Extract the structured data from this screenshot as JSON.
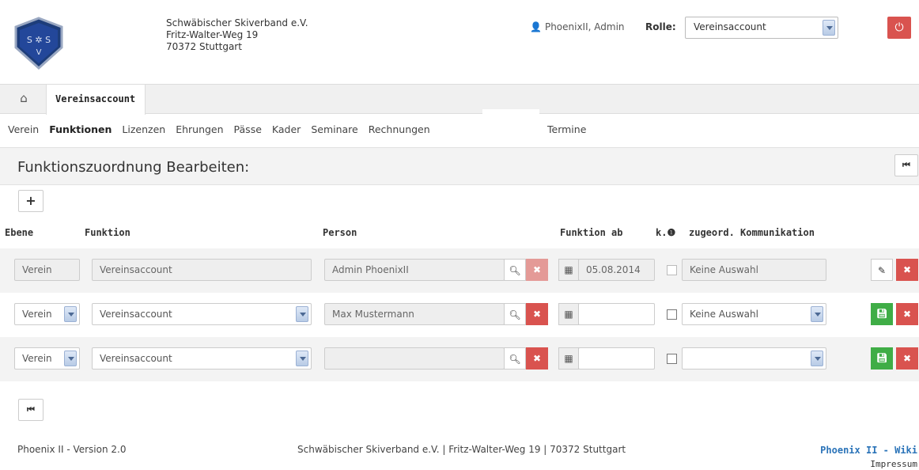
{
  "header": {
    "org_name": "Schwäbischer Skiverband e.V.",
    "org_street": "Fritz-Walter-Weg 19",
    "org_city": "70372 Stuttgart",
    "user": "PhoenixII, Admin",
    "role_label": "Rolle:",
    "role_value": "Vereinsaccount",
    "logo_text": "S S S V"
  },
  "tabs": {
    "active": "Vereinsaccount"
  },
  "subnav": {
    "items": [
      "Verein",
      "Funktionen",
      "Lizenzen",
      "Ehrungen",
      "Pässe",
      "Kader",
      "Seminare",
      "Rechnungen"
    ],
    "extra": "Termine"
  },
  "panel": {
    "title": "Funktionszuordnung Bearbeiten:"
  },
  "columns": {
    "ebene": "Ebene",
    "funktion": "Funktion",
    "person": "Person",
    "funktion_ab": "Funktion ab",
    "k": "k.",
    "kommunikation": "zugeord. Kommunikation"
  },
  "rows": [
    {
      "ebene": "Verein",
      "funktion": "Vereinsaccount",
      "person": "Admin PhoenixII",
      "datum": "05.08.2014",
      "kommunikation": "Keine Auswahl",
      "mode": "readonly"
    },
    {
      "ebene": "Verein",
      "funktion": "Vereinsaccount",
      "person": "Max Mustermann",
      "datum": "",
      "kommunikation": "Keine Auswahl",
      "mode": "edit"
    },
    {
      "ebene": "Verein",
      "funktion": "Vereinsaccount",
      "person": "",
      "datum": "",
      "kommunikation": "",
      "mode": "edit"
    }
  ],
  "footer": {
    "version": "Phoenix II - Version 2.0",
    "address": "Schwäbischer Skiverband e.V. | Fritz-Walter-Weg 19 | 70372 Stuttgart",
    "wiki": "Phoenix II - Wiki",
    "impressum": "Impressum"
  },
  "colors": {
    "danger": "#d9534f",
    "success": "#3fad46",
    "link": "#2a73b8"
  }
}
